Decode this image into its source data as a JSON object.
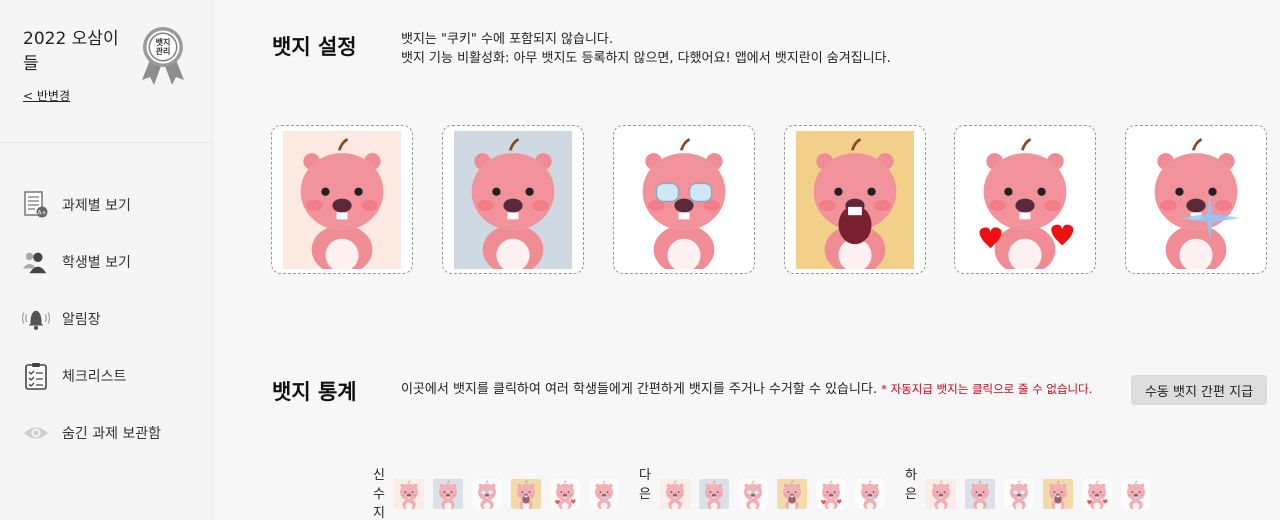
{
  "sidebar": {
    "class_title": "2022 오삼이들",
    "change_class_link": "< 반변경",
    "medal_text": "뱃지관리",
    "menu": [
      {
        "label": "과제별 보기",
        "icon": "document-icon"
      },
      {
        "label": "학생별 보기",
        "icon": "students-icon"
      },
      {
        "label": "알림장",
        "icon": "bell-icon"
      },
      {
        "label": "체크리스트",
        "icon": "checklist-icon"
      },
      {
        "label": "숨긴 과제 보관함",
        "icon": "eye-icon"
      }
    ]
  },
  "badge_settings": {
    "title": "뱃지 설정",
    "desc_line1": "뱃지는 \"쿠키\" 수에 포함되지 않습니다.",
    "desc_line2": "뱃지 기능 비활성화: 아무 뱃지도 등록하지 않으면, 다했어요! 앱에서 뱃지란이 숨겨집니다.",
    "badges": [
      {
        "name": "loopy-shy",
        "bg": "#fbe9e2"
      },
      {
        "name": "loopy-sitting",
        "bg": "#cfd9e2"
      },
      {
        "name": "loopy-crying",
        "bg": "#ffffff"
      },
      {
        "name": "loopy-shocked",
        "bg": "#f2d089"
      },
      {
        "name": "loopy-hearts",
        "bg": "#ffffff"
      },
      {
        "name": "loopy-sparkle",
        "bg": "#ffffff"
      }
    ]
  },
  "badge_stats": {
    "title": "뱃지 통계",
    "desc": "이곳에서 뱃지를 클릭하여 여러 학생들에게 간편하게 뱃지를 주거나 수거할 수 있습니다.",
    "warning": "* 자동지급 뱃지는 클릭으로 줄 수 없습니다.",
    "manual_grant_button": "수동 뱃지 간편 지급",
    "students": [
      {
        "name_chars": [
          "신",
          "수",
          "지"
        ]
      },
      {
        "name_chars": [
          "다",
          "은"
        ]
      },
      {
        "name_chars": [
          "하",
          "은"
        ]
      }
    ]
  }
}
